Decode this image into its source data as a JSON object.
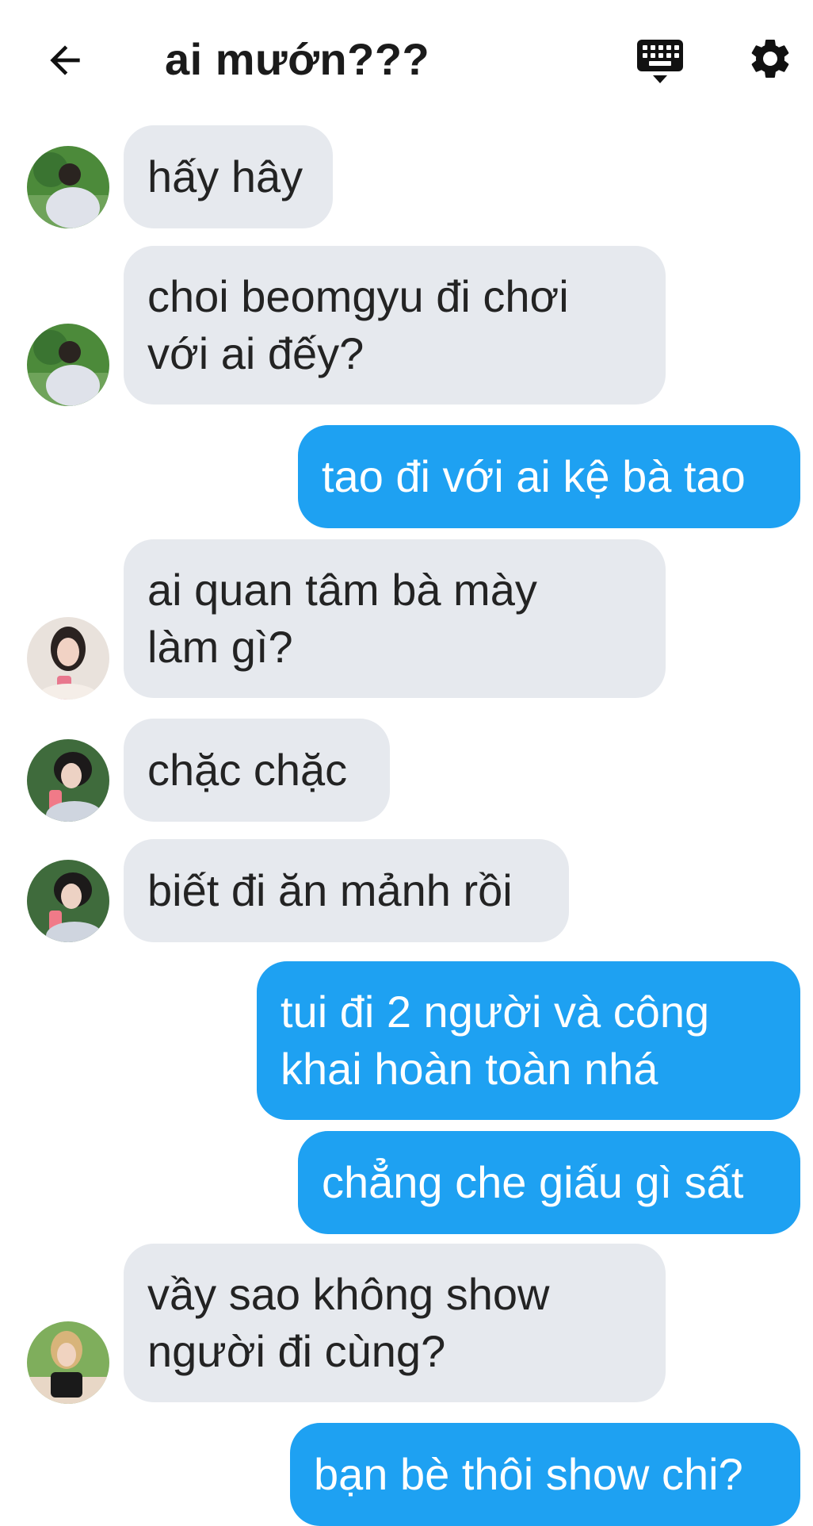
{
  "header": {
    "title": "ai mướn???",
    "back_icon": "arrow-left-icon",
    "keyboard_icon": "keyboard-icon",
    "settings_icon": "gear-icon"
  },
  "colors": {
    "incoming_bubble": "#e6e9ee",
    "outgoing_bubble": "#1ea1f2",
    "outgoing_text": "#ffffff",
    "background": "#ffffff"
  },
  "messages": [
    {
      "direction": "in",
      "text": "hấy hây"
    },
    {
      "direction": "in",
      "text": "choi beomgyu đi chơi\nvới ai đếy?"
    },
    {
      "direction": "out",
      "text": "tao đi với ai kệ bà tao"
    },
    {
      "direction": "in",
      "text": "ai quan tâm bà mày\nlàm gì?"
    },
    {
      "direction": "in",
      "text": "chặc chặc"
    },
    {
      "direction": "in",
      "text": "biết đi ăn mảnh rồi"
    },
    {
      "direction": "out",
      "text": "tui đi 2 người và công\nkhai hoàn toàn nhá"
    },
    {
      "direction": "out",
      "text": "chẳng che giấu gì sất"
    },
    {
      "direction": "in",
      "text": "vầy sao không show\nngười đi cùng?"
    },
    {
      "direction": "out",
      "text": "bạn bè thôi show chi?"
    }
  ]
}
